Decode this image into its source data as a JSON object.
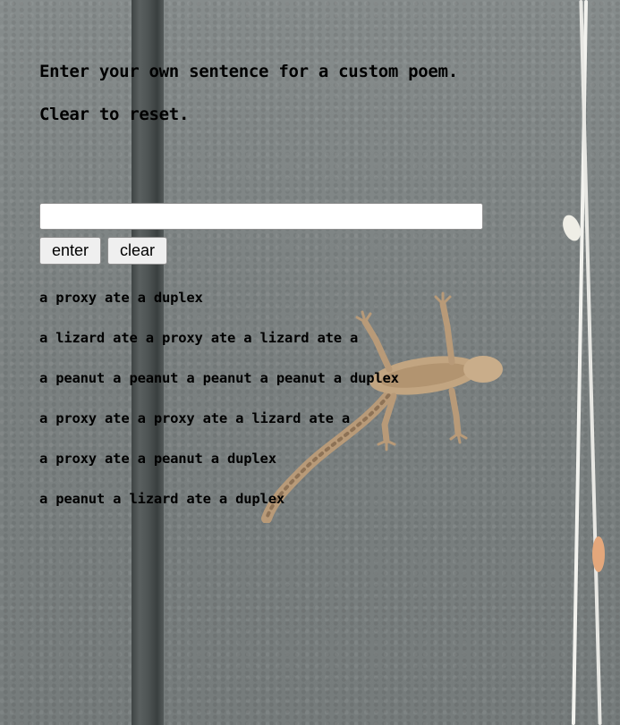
{
  "intro": {
    "line1": "Enter your own sentence for a custom poem.",
    "line2": "Clear to reset."
  },
  "form": {
    "input_value": "",
    "input_placeholder": "",
    "enter_label": "enter",
    "clear_label": "clear"
  },
  "poem": [
    "a proxy ate a duplex",
    "a lizard ate a proxy ate a lizard ate a",
    "a peanut a peanut a peanut a peanut a duplex",
    "a proxy ate a proxy ate a lizard ate a",
    "a proxy ate a peanut a duplex",
    "a peanut a lizard ate a duplex"
  ],
  "colors": {
    "background": "#7d8383",
    "text": "#000000",
    "button_bg": "#efefef"
  },
  "background_image": {
    "icon": "gecko-on-wall-photo"
  }
}
